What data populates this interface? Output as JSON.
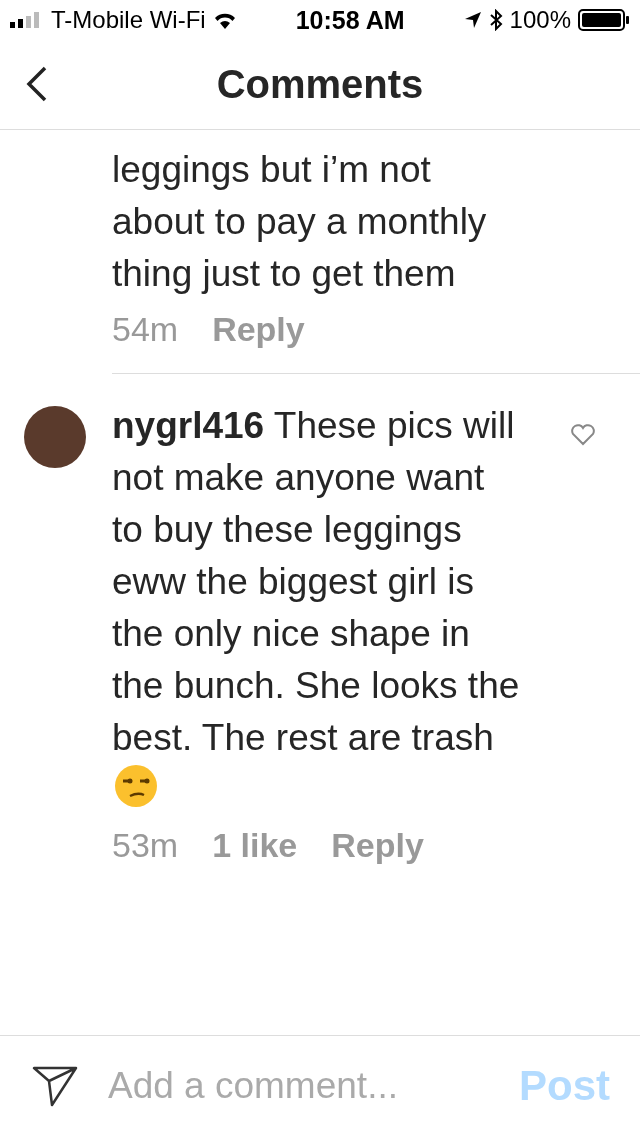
{
  "status_bar": {
    "carrier": "T-Mobile Wi-Fi",
    "time": "10:58 AM",
    "battery": "100%"
  },
  "header": {
    "title": "Comments"
  },
  "comments": [
    {
      "text": "leggings but i’m not about to pay a monthly thing just to get them",
      "time": "54m",
      "reply": "Reply"
    },
    {
      "username": "nygrl416",
      "text": "These pics will not make anyone want to buy these leggings eww the biggest girl is the only nice shape in the bunch. She looks the best. The rest are trash",
      "emoji": true,
      "avatar": true,
      "heart": true,
      "time": "53m",
      "likes": "1 like",
      "reply": "Reply"
    }
  ],
  "composer": {
    "placeholder": "Add a comment...",
    "post": "Post"
  }
}
